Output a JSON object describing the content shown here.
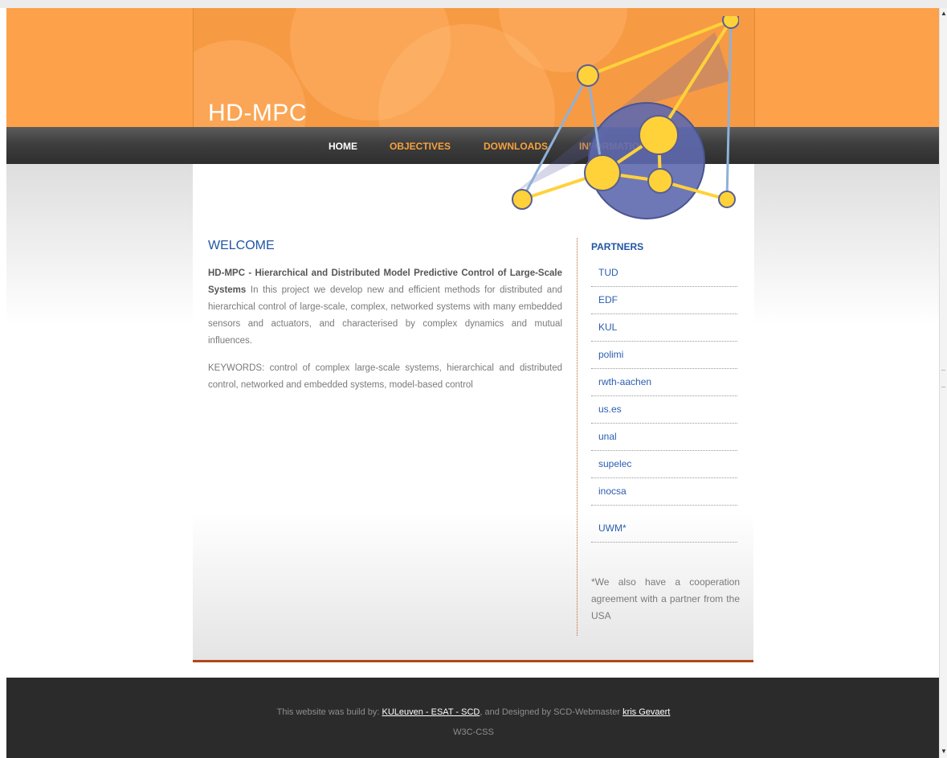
{
  "site": {
    "title": "HD-MPC"
  },
  "nav": {
    "home": "HOME",
    "objectives": "OBJECTIVES",
    "downloads": "DOWNLOADS",
    "information": "INFORMATION"
  },
  "main": {
    "heading": "WELCOME",
    "intro_bold": "HD-MPC - Hierarchical and Distributed Model Predictive Control of Large-Scale Systems",
    "intro_text": " In this project we develop new and efficient methods for distributed and hierarchical control of large-scale, complex, networked systems with many embedded sensors and actuators, and characterised by complex dynamics and mutual influences.",
    "keywords": "KEYWORDS: control of complex large-scale systems, hierarchical and distributed control, networked and embedded systems, model-based control"
  },
  "sidebar": {
    "heading": "PARTNERS",
    "partners": [
      "TUD",
      "EDF",
      "KUL",
      "polimi",
      "rwth-aachen",
      "us.es",
      "unal",
      "supelec",
      "inocsa"
    ],
    "extra_partner": "UWM*",
    "note": "*We also have a cooperation agreement with a partner from the USA"
  },
  "footer": {
    "prefix": "This website was build by: ",
    "builder_link": "KULeuven - ESAT - SCD",
    "middle": ", and Designed by SCD-Webmaster ",
    "designer_link": "kris Gevaert",
    "w3c": "W3C-CSS"
  },
  "colors": {
    "header_orange": "#fda14a",
    "link_blue": "#2b5db0",
    "nav_orange": "#f7a23c",
    "footer_bg": "#2b2b2b"
  },
  "icons": {
    "logo": "network-molecule-logo"
  }
}
